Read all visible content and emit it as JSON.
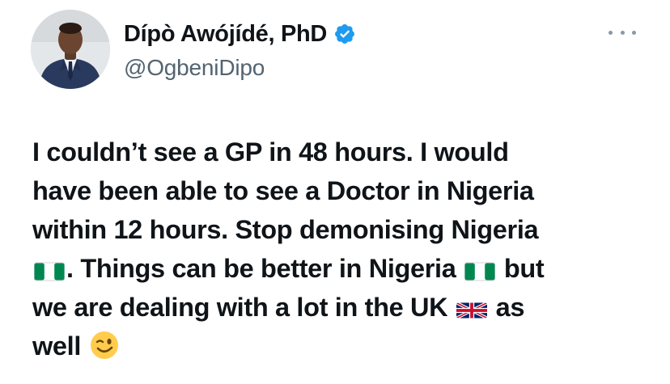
{
  "author": {
    "display_name": "Dípò Awójídé, PhD",
    "handle": "@OgbeniDipo",
    "verified_icon": "verified-badge-icon",
    "avatar_icon": "avatar",
    "accent_color": "#1d9bf0"
  },
  "menu": {
    "icon": "more-options-icon"
  },
  "tweet": {
    "line1": "I couldn’t see a GP in 48 hours. I would",
    "line2": "have been able to see a Doctor in Nigeria",
    "line3": "within 12 hours. Stop demonising Nigeria",
    "line4a": ". Things can be better in Nigeria",
    "line4b": "but",
    "line5a": "we are dealing with a lot in the UK",
    "line5b": "as",
    "line6a": "well",
    "emojis": [
      "nigeria-flag",
      "nigeria-flag",
      "uk-flag",
      "winking-face"
    ]
  },
  "colors": {
    "text": "#0f1419",
    "secondary_text": "#536471",
    "nigeria_green": "#008751",
    "verified_blue": "#1d9bf0"
  }
}
